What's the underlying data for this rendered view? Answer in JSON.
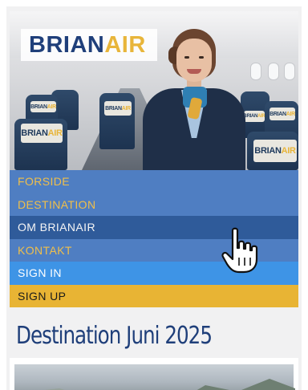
{
  "brand": {
    "name_part1": "BRIAN",
    "name_part2": "AIR",
    "headrest_part1": "BRIAN",
    "headrest_part2": "AIR"
  },
  "nav": {
    "items": [
      {
        "label": "FORSIDE",
        "state": "default"
      },
      {
        "label": "DESTINATION",
        "state": "default"
      },
      {
        "label": "OM BRIANAIR",
        "state": "active"
      },
      {
        "label": "KONTAKT",
        "state": "default"
      },
      {
        "label": "SIGN IN",
        "state": "signin"
      },
      {
        "label": "SIGN UP",
        "state": "signup"
      }
    ]
  },
  "main": {
    "heading": "Destination Juni 2025"
  },
  "icons": {
    "cursor": "hand-pointer-icon"
  },
  "colors": {
    "brand_blue": "#1f3f7a",
    "brand_gold": "#e8b53a",
    "menu_blue": "#4f7ec2",
    "menu_active": "#2f5b9a",
    "signin_blue": "#3e94e6",
    "signup_gold": "#e8b434"
  }
}
